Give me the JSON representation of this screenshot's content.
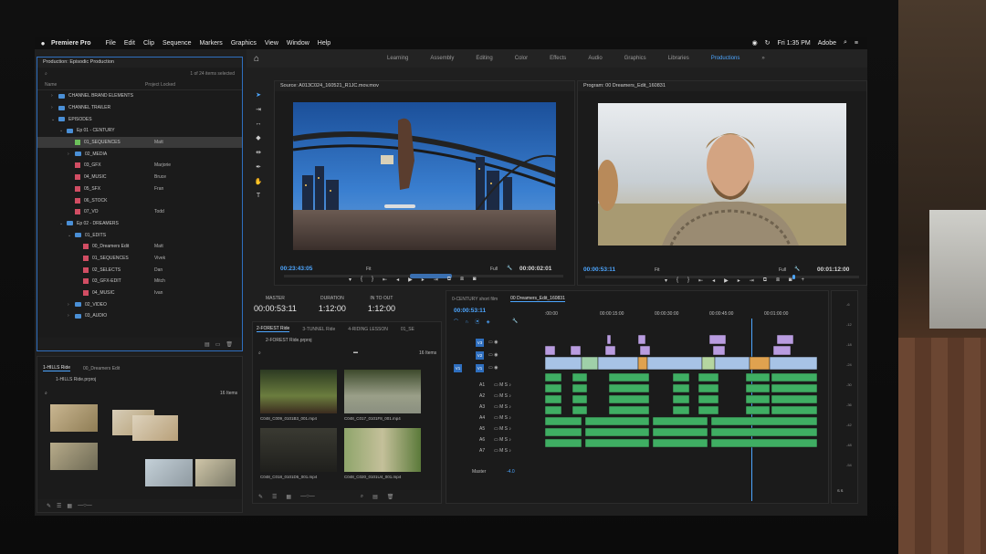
{
  "menubar": {
    "apple": "",
    "app": "Premiere Pro",
    "items": [
      "File",
      "Edit",
      "Clip",
      "Sequence",
      "Markers",
      "Graphics",
      "View",
      "Window",
      "Help"
    ],
    "clock": "Fri 1:35 PM",
    "user": "Adobe"
  },
  "workspaces": {
    "tabs": [
      "Learning",
      "Assembly",
      "Editing",
      "Color",
      "Effects",
      "Audio",
      "Graphics",
      "Libraries",
      "Productions"
    ],
    "active": "Productions"
  },
  "project": {
    "title": "Production: Episodic Production",
    "count": "1 of 24 items selected",
    "col_name": "Name",
    "col_locked": "Project Locked",
    "rows": [
      {
        "label": "CHANNEL BRAND ELEMENTS",
        "owner": "",
        "type": "folder",
        "indent": 1,
        "arrow": "›"
      },
      {
        "label": "CHANNEL TRAILER",
        "owner": "",
        "type": "folder",
        "indent": 1,
        "arrow": "›"
      },
      {
        "label": "EPISODES",
        "owner": "",
        "type": "folder",
        "indent": 1,
        "arrow": "⌄"
      },
      {
        "label": "Ep 01 - CENTURY",
        "owner": "",
        "type": "folder",
        "indent": 2,
        "arrow": "⌄"
      },
      {
        "label": "01_SEQUENCES",
        "owner": "Matt",
        "type": "seq-green",
        "indent": 3,
        "arrow": "",
        "hl": true
      },
      {
        "label": "02_MEDIA",
        "owner": "",
        "type": "folder",
        "indent": 3,
        "arrow": "›"
      },
      {
        "label": "03_GFX",
        "owner": "Marjorie",
        "type": "seq",
        "indent": 3,
        "arrow": ""
      },
      {
        "label": "04_MUSIC",
        "owner": "Bruce",
        "type": "seq",
        "indent": 3,
        "arrow": ""
      },
      {
        "label": "05_SFX",
        "owner": "Fran",
        "type": "seq",
        "indent": 3,
        "arrow": ""
      },
      {
        "label": "06_STOCK",
        "owner": "",
        "type": "seq",
        "indent": 3,
        "arrow": ""
      },
      {
        "label": "07_VO",
        "owner": "Todd",
        "type": "seq",
        "indent": 3,
        "arrow": ""
      },
      {
        "label": "Ep 02 - DREAMERS",
        "owner": "",
        "type": "folder",
        "indent": 2,
        "arrow": "⌄"
      },
      {
        "label": "01_EDITS",
        "owner": "",
        "type": "folder",
        "indent": 3,
        "arrow": "⌄"
      },
      {
        "label": "00_Dreamers Edit",
        "owner": "Matt",
        "type": "seq",
        "indent": 4,
        "arrow": ""
      },
      {
        "label": "01_SEQUENCES",
        "owner": "Vivek",
        "type": "seq",
        "indent": 4,
        "arrow": ""
      },
      {
        "label": "02_SELECTS",
        "owner": "Dan",
        "type": "seq",
        "indent": 4,
        "arrow": ""
      },
      {
        "label": "03_GFX-EDIT",
        "owner": "Mitch",
        "type": "seq",
        "indent": 4,
        "arrow": ""
      },
      {
        "label": "04_MUSIC",
        "owner": "Ivan",
        "type": "seq",
        "indent": 4,
        "arrow": ""
      },
      {
        "label": "02_VIDEO",
        "owner": "",
        "type": "folder",
        "indent": 3,
        "arrow": "›"
      },
      {
        "label": "03_AUDIO",
        "owner": "",
        "type": "folder",
        "indent": 3,
        "arrow": "›"
      }
    ]
  },
  "bin2": {
    "tabs": [
      "1-HILLS Ride",
      "00_Dreamers Edit"
    ],
    "file": "1-HILLS Ride.prproj",
    "count": "16 Items"
  },
  "source": {
    "title": "Source: A013C024_160521_R1JC.mov.mov",
    "tc_in": "00:23:43:05",
    "fit": "Fit",
    "full": "Full",
    "tc_out": "00:00:02:01"
  },
  "program": {
    "title": "Program: 00 Dreamers_Edit_160831",
    "tc_in": "00:00:53:11",
    "fit": "Fit",
    "full": "Full",
    "tc_out": "00:01:12:00"
  },
  "info": {
    "master_k": "MASTER",
    "master_v": "00:00:53:11",
    "duration_k": "DURATION",
    "duration_v": "1:12:00",
    "inout_k": "IN TO OUT",
    "inout_v": "1:12:00"
  },
  "bin3": {
    "tabs": [
      "2-FOREST Ride",
      "3-TUNNEL Ride",
      "4-RIDING LESSON",
      "01_SE"
    ],
    "file": "2-FOREST Ride.prproj",
    "count": "16 Items",
    "clips": [
      "C048_C009_0101B3_001.mp4",
      "C048_C017_0101F8_001.mp4",
      "C048_C018_0101D5_001.mp4",
      "C048_C020_0101U4_001.mp4"
    ]
  },
  "timeline": {
    "tabs": [
      "0-CENTURY short film",
      "00 Dreamers_Edit_160831"
    ],
    "tc": "00:00:53:11",
    "ruler": [
      ":00:00",
      "00:00:15:00",
      "00:00:30:00",
      "00:00:45:00",
      "00:01:00:00"
    ],
    "video_tracks": [
      "V3",
      "V2",
      "V1"
    ],
    "audio_tracks": [
      "A1",
      "A2",
      "A3",
      "A4",
      "A5",
      "A6",
      "A7"
    ],
    "master_label": "Master",
    "master_value": "-4.0",
    "playhead_fraction": 0.757
  },
  "meter": {
    "labels": [
      "-6",
      "-12",
      "-18",
      "-24",
      "-30",
      "-36",
      "-42",
      "-48",
      "-54"
    ],
    "bottom": "S  S"
  },
  "colors": {
    "accent": "#4da6ff",
    "audio_clip": "#3fae63",
    "video_clip": "#a7c3e6",
    "title_clip": "#b99ce0",
    "seq_icon": "#d14d63",
    "folder": "#4a8fd6"
  }
}
